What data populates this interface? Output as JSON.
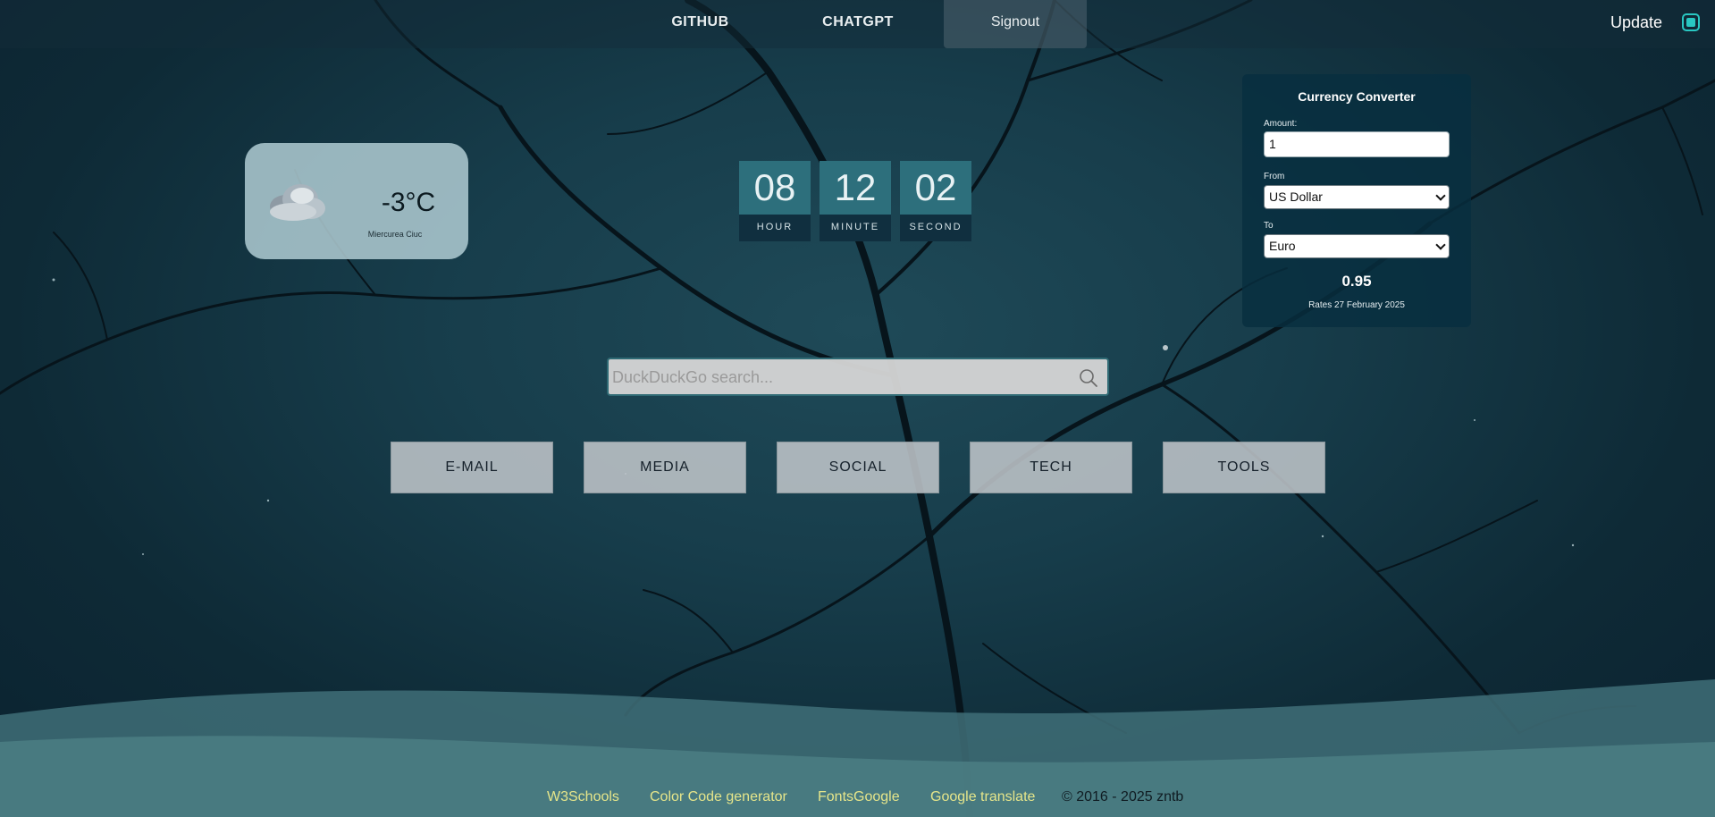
{
  "nav": {
    "github": "GITHUB",
    "chatgpt": "CHATGPT",
    "signout": "Signout",
    "update_label": "Update"
  },
  "weather": {
    "icon": "cloud-icon",
    "temperature": "-3°C",
    "city": "Miercurea Ciuc"
  },
  "clock": {
    "hour": "08",
    "minute": "12",
    "second": "02",
    "hour_label": "HOUR",
    "minute_label": "MINUTE",
    "second_label": "SECOND"
  },
  "converter": {
    "title": "Currency Converter",
    "amount_label": "Amount:",
    "amount_value": "1",
    "from_label": "From",
    "from_value": "US Dollar",
    "to_label": "To",
    "to_value": "Euro",
    "result": "0.95",
    "rates": "Rates 27 February 2025"
  },
  "search": {
    "placeholder": "DuckDuckGo search..."
  },
  "categories": [
    "E-MAIL",
    "MEDIA",
    "SOCIAL",
    "TECH",
    "TOOLS"
  ],
  "footer": {
    "links": [
      "W3Schools",
      "Color Code generator",
      "FontsGoogle",
      "Google translate"
    ],
    "copyright": "© 2016 - 2025 zntb"
  },
  "colors": {
    "accent": "#29c7c2",
    "footer_link": "#e5e58a",
    "clock_digit_bg": "#2d6f7c",
    "clock_label_bg": "#102f3f"
  }
}
